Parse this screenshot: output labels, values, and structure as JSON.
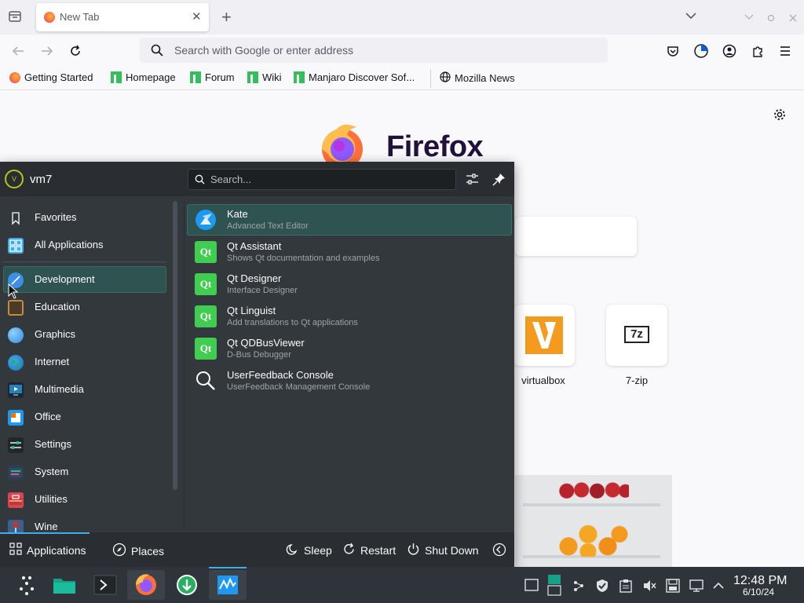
{
  "browser": {
    "tab_title": "New Tab",
    "tab_close": "✕",
    "new_tab": "+",
    "url_placeholder": "Search with Google or enter address",
    "bookmarks": [
      "Getting Started",
      "Homepage",
      "Forum",
      "Wiki",
      "Manjaro Discover Sof...",
      "Mozilla News"
    ]
  },
  "page": {
    "brand": "Firefox",
    "shortcuts": [
      {
        "label": "virtualbox"
      },
      {
        "label": "7-zip"
      }
    ],
    "sevenzip_logo": "7z"
  },
  "launcher": {
    "user_initial": "V",
    "username": "vm7",
    "search_placeholder": "Search...",
    "categories": [
      {
        "label": "Favorites",
        "icon": "bookmark-icon"
      },
      {
        "label": "All Applications",
        "icon": "grid-icon"
      },
      {
        "label": "Development",
        "icon": "development-icon"
      },
      {
        "label": "Education",
        "icon": "education-icon"
      },
      {
        "label": "Graphics",
        "icon": "graphics-icon"
      },
      {
        "label": "Internet",
        "icon": "globe-icon"
      },
      {
        "label": "Multimedia",
        "icon": "multimedia-icon"
      },
      {
        "label": "Office",
        "icon": "office-icon"
      },
      {
        "label": "Settings",
        "icon": "settings-icon"
      },
      {
        "label": "System",
        "icon": "system-icon"
      },
      {
        "label": "Utilities",
        "icon": "utilities-icon"
      },
      {
        "label": "Wine",
        "icon": "wine-icon"
      }
    ],
    "apps": [
      {
        "name": "Kate",
        "desc": "Advanced Text Editor"
      },
      {
        "name": "Qt Assistant",
        "desc": "Shows Qt documentation and examples"
      },
      {
        "name": "Qt Designer",
        "desc": "Interface Designer"
      },
      {
        "name": "Qt Linguist",
        "desc": "Add translations to Qt applications"
      },
      {
        "name": "Qt QDBusViewer",
        "desc": "D-Bus Debugger"
      },
      {
        "name": "UserFeedback Console",
        "desc": "UserFeedback Management Console"
      }
    ],
    "qt_glyph": "Qt",
    "footer": {
      "applications": "Applications",
      "places": "Places",
      "sleep": "Sleep",
      "restart": "Restart",
      "shutdown": "Shut Down"
    }
  },
  "taskbar": {
    "time": "12:48 PM",
    "date": "6/10/24"
  },
  "colors": {
    "launcher_bg": "#33383d",
    "highlight": "#2f5350",
    "accent": "#3daee9",
    "qt_green": "#41cd52"
  }
}
